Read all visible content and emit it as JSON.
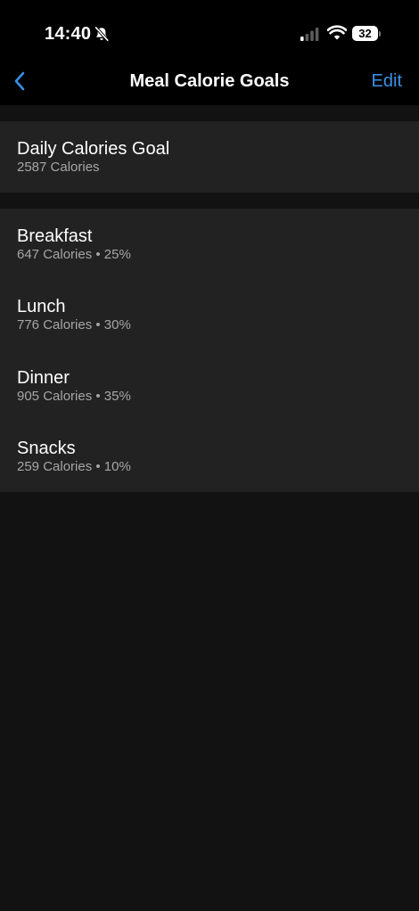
{
  "status_bar": {
    "time": "14:40",
    "battery_level": "32",
    "icons": [
      "bell-slash-icon",
      "cellular-signal-icon",
      "wifi-icon",
      "battery-icon"
    ]
  },
  "nav": {
    "back_icon": "chevron-left-icon",
    "title": "Meal Calorie Goals",
    "edit_label": "Edit"
  },
  "daily_goal": {
    "title": "Daily Calories Goal",
    "subtitle": "2587 Calories"
  },
  "meals": [
    {
      "name": "Breakfast",
      "detail": "647 Calories • 25%"
    },
    {
      "name": "Lunch",
      "detail": "776 Calories • 30%"
    },
    {
      "name": "Dinner",
      "detail": "905 Calories • 35%"
    },
    {
      "name": "Snacks",
      "detail": "259 Calories • 10%"
    }
  ],
  "colors": {
    "accent": "#3b8fe6",
    "background": "#121212",
    "bar_background": "#000000",
    "cell_background": "#222222",
    "secondary_text": "#a6a6a6"
  }
}
